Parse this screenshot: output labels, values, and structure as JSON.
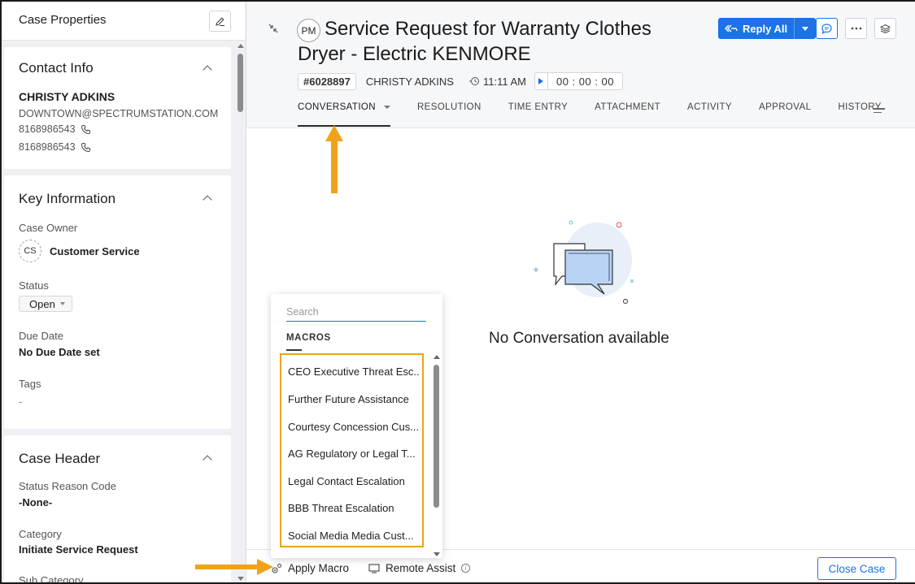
{
  "sidebar": {
    "title": "Case Properties",
    "contact_info": {
      "title": "Contact Info",
      "name": "CHRISTY ADKINS",
      "email": "DOWNTOWN@SPECTRUMSTATION.COM",
      "phones": [
        "8168986543",
        "8168986543"
      ]
    },
    "key_information": {
      "title": "Key Information",
      "case_owner_label": "Case Owner",
      "case_owner_initials": "CS",
      "case_owner_name": "Customer Service",
      "status_label": "Status",
      "status_value": "Open",
      "due_date_label": "Due Date",
      "due_date_value": "No Due Date set",
      "tags_label": "Tags",
      "tags_value": "-"
    },
    "case_header": {
      "title": "Case Header",
      "status_reason_label": "Status Reason Code",
      "status_reason_value": "-None-",
      "category_label": "Category",
      "category_value": "Initiate Service Request",
      "sub_category_label": "Sub Category"
    }
  },
  "ticket": {
    "avatar_initials": "PM",
    "subject": "Service Request for Warranty Clothes Dryer - Electric KENMORE",
    "number": "#6028897",
    "contact": "CHRISTY ADKINS",
    "time": "11:11 AM",
    "timer": "00 : 00 : 00"
  },
  "toolbar": {
    "reply_all_label": "Reply All"
  },
  "tabs": [
    {
      "label": "CONVERSATION"
    },
    {
      "label": "RESOLUTION"
    },
    {
      "label": "TIME ENTRY"
    },
    {
      "label": "ATTACHMENT"
    },
    {
      "label": "ACTIVITY"
    },
    {
      "label": "APPROVAL"
    },
    {
      "label": "HISTORY"
    }
  ],
  "conversation": {
    "empty_text": "No Conversation available"
  },
  "macro_popup": {
    "search_placeholder": "Search",
    "section_title": "MACROS",
    "items": [
      "CEO Executive Threat Esc...",
      "Further Future Assistance",
      "Courtesy Concession Cus...",
      "AG Regulatory or Legal T...",
      "Legal Contact Escalation",
      "BBB Threat Escalation",
      "Social Media Media Cust..."
    ]
  },
  "bottom_bar": {
    "apply_macro_label": "Apply Macro",
    "remote_assist_label": "Remote Assist",
    "close_case_label": "Close Case"
  },
  "colors": {
    "accent_blue": "#1a73e8",
    "annotation_orange": "#f0a21a",
    "sidebar_bg": "#eef0f4"
  },
  "icons": [
    "edit-icon",
    "phone-icon",
    "collapse-icon",
    "reply-all-icon",
    "chat-icon",
    "more-icon",
    "layers-icon",
    "clock-icon",
    "play-icon",
    "menu-icon",
    "macro-icon",
    "monitor-icon",
    "info-icon"
  ]
}
